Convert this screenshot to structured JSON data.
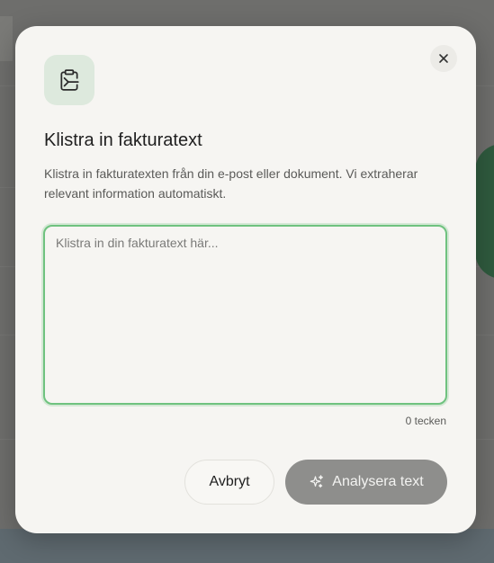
{
  "modal": {
    "title": "Klistra in fakturatext",
    "description": "Klistra in fakturatexten från din e-post eller dokument. Vi extraherar relevant information automatiskt.",
    "header_icon": "clipboard-paste-icon",
    "close_icon": "close-icon"
  },
  "input": {
    "placeholder": "Klistra in din fakturatext här...",
    "value": "",
    "char_count": "0 tecken"
  },
  "actions": {
    "cancel_label": "Avbryt",
    "analyze_label": "Analysera text",
    "analyze_icon": "sparkles-icon"
  },
  "colors": {
    "focus_border": "#6fc27f",
    "icon_tile_bg": "#dde9dd",
    "analyze_button_bg": "#8e8e8c",
    "modal_bg": "#f6f5f2"
  }
}
